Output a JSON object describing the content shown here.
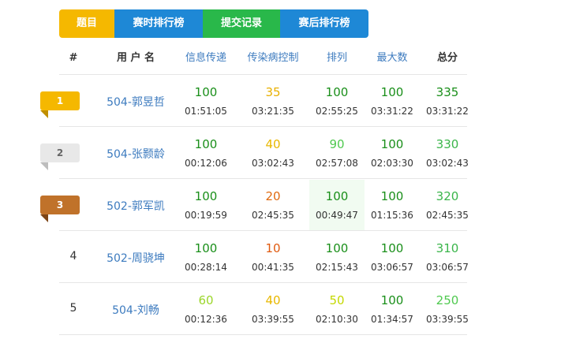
{
  "tabs": [
    "题目",
    "赛时排行榜",
    "提交记录",
    "赛后排行榜"
  ],
  "headers": {
    "rank": "#",
    "user": "用 户 名",
    "problems": [
      "信息传递",
      "传染病控制",
      "排列",
      "最大数"
    ],
    "total": "总分"
  },
  "colors": {
    "gold": "#f5b800",
    "silver": "#e8e8e8",
    "bronze": "#c0722a",
    "score_100": "#1a8f1a",
    "score_90": "#4fc94f",
    "score_60": "#9bd62a",
    "score_50": "#c4d800",
    "score_40": "#e8b800",
    "score_35": "#e8b000",
    "score_20": "#e06a10",
    "score_10": "#e05a10"
  },
  "rows": [
    {
      "rank": "1",
      "user": "504-郭昱哲",
      "cells": [
        {
          "score": "100",
          "time": "01:51:05"
        },
        {
          "score": "35",
          "time": "03:21:35"
        },
        {
          "score": "100",
          "time": "02:55:25"
        },
        {
          "score": "100",
          "time": "03:31:22"
        }
      ],
      "total": {
        "score": "335",
        "time": "03:31:22"
      }
    },
    {
      "rank": "2",
      "user": "504-张颢龄",
      "cells": [
        {
          "score": "100",
          "time": "00:12:06"
        },
        {
          "score": "40",
          "time": "03:02:43"
        },
        {
          "score": "90",
          "time": "02:57:08"
        },
        {
          "score": "100",
          "time": "02:03:30"
        }
      ],
      "total": {
        "score": "330",
        "time": "03:02:43"
      }
    },
    {
      "rank": "3",
      "user": "502-郭军凯",
      "cells": [
        {
          "score": "100",
          "time": "00:19:59"
        },
        {
          "score": "20",
          "time": "02:45:35"
        },
        {
          "score": "100",
          "time": "00:49:47"
        },
        {
          "score": "100",
          "time": "01:15:36"
        }
      ],
      "total": {
        "score": "320",
        "time": "02:45:35"
      }
    },
    {
      "rank": "4",
      "user": "502-周骁坤",
      "cells": [
        {
          "score": "100",
          "time": "00:28:14"
        },
        {
          "score": "10",
          "time": "00:41:35"
        },
        {
          "score": "100",
          "time": "02:15:43"
        },
        {
          "score": "100",
          "time": "03:06:57"
        }
      ],
      "total": {
        "score": "310",
        "time": "03:06:57"
      }
    },
    {
      "rank": "5",
      "user": "504-刘畅",
      "cells": [
        {
          "score": "60",
          "time": "00:12:36"
        },
        {
          "score": "40",
          "time": "03:39:55"
        },
        {
          "score": "50",
          "time": "02:10:30"
        },
        {
          "score": "100",
          "time": "01:34:57"
        }
      ],
      "total": {
        "score": "250",
        "time": "03:39:55"
      }
    }
  ]
}
